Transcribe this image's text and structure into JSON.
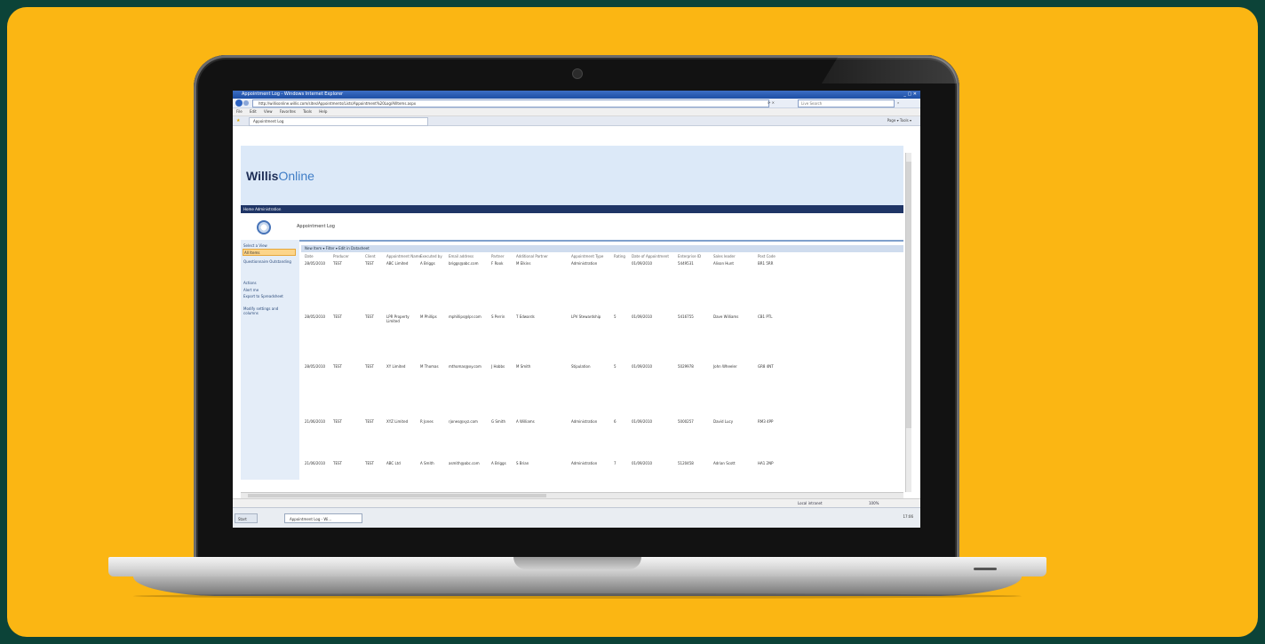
{
  "browser": {
    "window_title": "Appointment Log - Windows Internet Explorer",
    "url": "http://willisonline.willis.com/sites/Appointments/Lists/Appointment%20Log/AllItems.aspx",
    "search_placeholder": "Live Search",
    "menu": [
      "File",
      "Edit",
      "View",
      "Favorites",
      "Tools",
      "Help"
    ],
    "tab_label": "Appointment Log",
    "toolbar_right": "Page ▾  Tools ▾"
  },
  "site": {
    "logo_bold": "Willis",
    "logo_light": "Online",
    "nav": "Home   Administration",
    "page_title": "Appointment Log"
  },
  "left_nav": {
    "select_view": "Select a View",
    "views": [
      "All Items",
      "Questionnaire Outstanding"
    ],
    "actions_label": "Actions",
    "actions": [
      "Alert me",
      "Export to Spreadsheet",
      "Modify settings and columns"
    ]
  },
  "list_toolbar": "New Item ▾   Filter ▾   Edit in Datasheet",
  "columns": [
    "Date",
    "Producer",
    "Client",
    "Appointment Name",
    "Executed by",
    "Email address",
    "Partner",
    "Additional Partner",
    "Appointment Type",
    "Rating",
    "Date of Appointment",
    "Enterprise ID",
    "Sales leader",
    "Post Code"
  ],
  "rows": [
    {
      "date": "28/05/2010",
      "producer": "TEST",
      "client": "TEST",
      "appointment": "ABC Limited",
      "executed": "A Briggs",
      "email": "briggs@abc.com",
      "partner": "F Rook",
      "add_partner": "M Elkins",
      "type": "Administration",
      "rating": "",
      "date_appt": "01/09/2010",
      "enterprise": "5449531",
      "leader": "Alison Hunt",
      "postcode": "BR1 5RR"
    },
    {
      "date": "28/05/2010",
      "producer": "TEST",
      "client": "TEST",
      "appointment": "LPR Property Limited",
      "executed": "M Phillips",
      "email": "mphillips@lpr.com",
      "partner": "S Perrin",
      "add_partner": "T Edwards",
      "type": "LPV Stewardship",
      "rating": "5",
      "date_appt": "01/09/2010",
      "enterprise": "5416755",
      "leader": "Dave Williams",
      "postcode": "CB1 PTL"
    },
    {
      "date": "28/05/2010",
      "producer": "TEST",
      "client": "TEST",
      "appointment": "XY Limited",
      "executed": "M Thomas",
      "email": "mthomas@xy.com",
      "partner": "J Hobbs",
      "add_partner": "M Smith",
      "type": "Stipulation",
      "rating": "5",
      "date_appt": "01/09/2010",
      "enterprise": "5029978",
      "leader": "John Wheeler",
      "postcode": "GR8 4NT"
    },
    {
      "date": "21/06/2010",
      "producer": "TEST",
      "client": "TEST",
      "appointment": "XYZ Limited",
      "executed": "R Jones",
      "email": "rjones@xyz.com",
      "partner": "G Smith",
      "add_partner": "A Williams",
      "type": "Administration",
      "rating": "6",
      "date_appt": "01/09/2010",
      "enterprise": "5000257",
      "leader": "David Lucy",
      "postcode": "RM3 4PP"
    },
    {
      "date": "21/06/2010",
      "producer": "TEST",
      "client": "TEST",
      "appointment": "ABC Ltd",
      "executed": "A Smith",
      "email": "asmith@abc.com",
      "partner": "A Briggs",
      "add_partner": "S Brian",
      "type": "Administration",
      "rating": "7",
      "date_appt": "01/09/2010",
      "enterprise": "5120458",
      "leader": "Adrian Scott",
      "postcode": "HA1 2NP"
    }
  ],
  "status": {
    "zone": "Local intranet",
    "zoom": "100%"
  },
  "taskbar": {
    "start": "Start",
    "item": "Appointment Log - Wi...",
    "clock": "17:06"
  }
}
